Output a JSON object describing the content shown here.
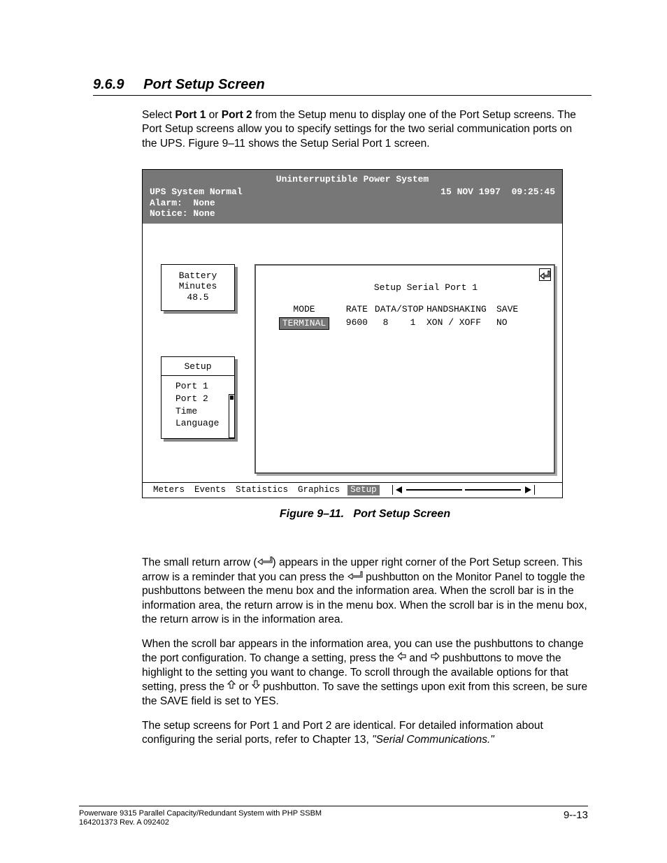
{
  "section": {
    "number": "9.6.9",
    "title": "Port Setup Screen"
  },
  "intro": {
    "p1a": "Select ",
    "p1b": "Port 1",
    "p1c": " or ",
    "p1d": "Port 2",
    "p1e": " from the Setup menu to display one of the Port Setup screens.  The Port Setup screens allow you to specify settings for the two serial communication ports on the UPS.  Figure 9–11 shows the Setup Serial Port 1 screen."
  },
  "screen": {
    "title": "Uninterruptible Power System",
    "status": "UPS System Normal",
    "datetime": "15 NOV 1997  09:25:45",
    "alarm": "Alarm:  None",
    "notice": "Notice: None",
    "battery": {
      "l1": "Battery",
      "l2": "Minutes",
      "l3": "48.5"
    },
    "setup": {
      "title": "Setup",
      "items": [
        "Port 1",
        "Port 2",
        "Time",
        "Language"
      ],
      "selected": 0
    },
    "port": {
      "title": "Setup Serial Port 1",
      "headers": {
        "mode": "MODE",
        "rate": "RATE",
        "ds": "DATA/STOP",
        "hs": "HANDSHAKING",
        "sv": "SAVE"
      },
      "values": {
        "mode": "TERMINAL",
        "rate": "9600",
        "d": "8",
        "s": "1",
        "hs": "XON / XOFF",
        "sv": "NO"
      }
    },
    "footer_tabs": [
      "Meters",
      "Events",
      "Statistics",
      "Graphics",
      "Setup"
    ],
    "footer_active": 4
  },
  "caption": "Figure 9–11.   Port Setup Screen",
  "body": {
    "p2a": "The small return arrow (",
    "p2b": ") appears in the upper right corner of the Port Setup screen.  This arrow is a reminder that you can press the ",
    "p2c": " pushbutton on the Monitor Panel to toggle the pushbuttons between the menu box and the information area.  When the scroll bar is in the information area, the return arrow is in the menu box.  When the scroll bar is in the menu box, the return arrow is in the information area.",
    "p3a": "When the scroll bar appears in the information area, you can use the pushbuttons to change the port configuration.  To change a setting, press the ",
    "p3b": " and ",
    "p3c": " pushbuttons to move the highlight to the setting you want to change.  To scroll through the available options for that setting, press the  ",
    "p3d": " or ",
    "p3e": " pushbutton.  To save the settings upon exit from this screen, be sure the SAVE field is set to YES.",
    "p4a": "The setup screens for Port 1 and Port 2 are identical.  For detailed information about configuring the serial ports, refer to Chapter 13, ",
    "p4b": "\"Serial Communications.\""
  },
  "pagefoot": {
    "l1": "Powerware 9315 Parallel Capacity/Redundant System with PHP SSBM",
    "l2": "164201373    Rev. A      092402",
    "pn": "9--13"
  }
}
